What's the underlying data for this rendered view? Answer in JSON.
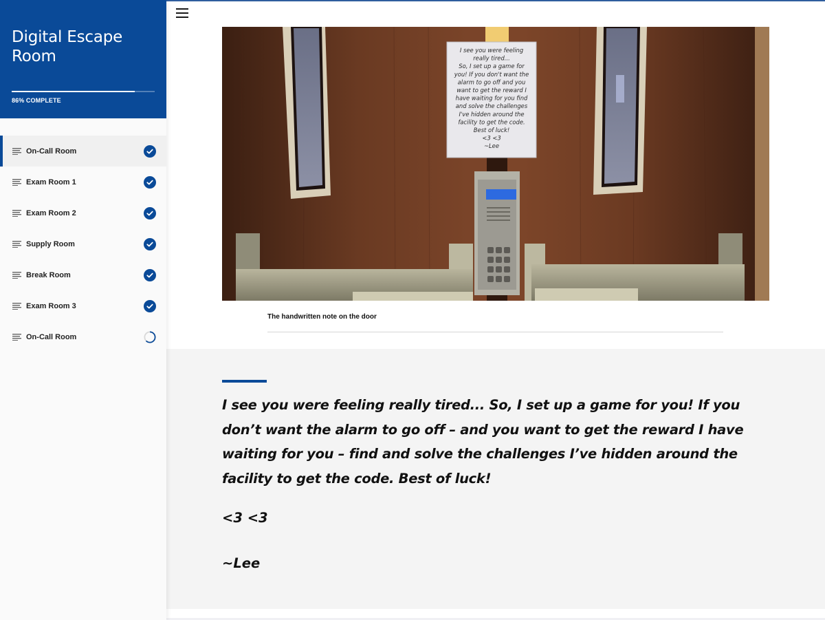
{
  "sidebar": {
    "course_title": "Digital Escape Room",
    "progress": {
      "percent": 86,
      "label": "86% COMPLETE"
    },
    "lessons": [
      {
        "label": "On-Call Room",
        "status": "complete",
        "active": true
      },
      {
        "label": "Exam Room 1",
        "status": "complete",
        "active": false
      },
      {
        "label": "Exam Room 2",
        "status": "complete",
        "active": false
      },
      {
        "label": "Supply Room",
        "status": "complete",
        "active": false
      },
      {
        "label": "Break Room",
        "status": "complete",
        "active": false
      },
      {
        "label": "Exam Room 3",
        "status": "complete",
        "active": false
      },
      {
        "label": "On-Call Room",
        "status": "in-progress",
        "active": false
      }
    ]
  },
  "main": {
    "menu_icon": "hamburger-icon",
    "figure": {
      "description": "Door with handwritten note and keypad",
      "note_lines": [
        "I see you were feeling",
        "really tired...",
        "So, I set up a game for",
        "you! If you don't want the",
        "alarm to go off and you",
        "want to get the reward I",
        "have waiting for you find",
        "and solve the challenges",
        "I've hidden around the",
        "facility to get the code.",
        "Best of luck!",
        "<3 <3",
        "~Lee"
      ],
      "caption": "The handwritten note on the door"
    },
    "quote": {
      "body": "I see you were feeling really tired... So, I set up a game for you! If you don’t want the alarm to go off – and you want to get the reward I have waiting for you – find and solve the challenges I’ve hidden around the facility to get the code. Best of luck!",
      "hearts": "<3 <3",
      "signature": "~Lee"
    }
  },
  "colors": {
    "brand": "#0a4a98",
    "sidebar_bg": "#fafafa",
    "quote_bg": "#f4f4f4"
  }
}
